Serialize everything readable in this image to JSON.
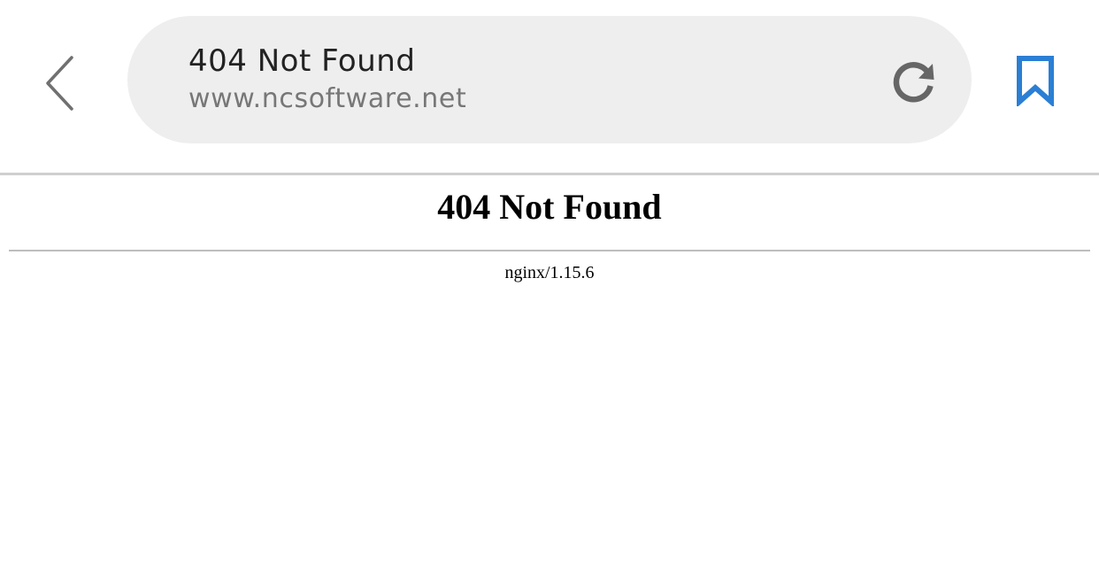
{
  "toolbar": {
    "back_icon": "chevron-left-icon",
    "page_title": "404 Not Found",
    "url": "www.ncsoftware.net",
    "reload_icon": "reload-icon",
    "bookmark_icon": "bookmark-icon"
  },
  "page": {
    "heading": "404 Not Found",
    "server": "nginx/1.15.6"
  },
  "colors": {
    "address_bar_bg": "#eeeeee",
    "back_icon": "#707070",
    "reload_icon": "#666666",
    "bookmark_icon": "#2a7fd4",
    "divider": "#cfcfcf"
  }
}
